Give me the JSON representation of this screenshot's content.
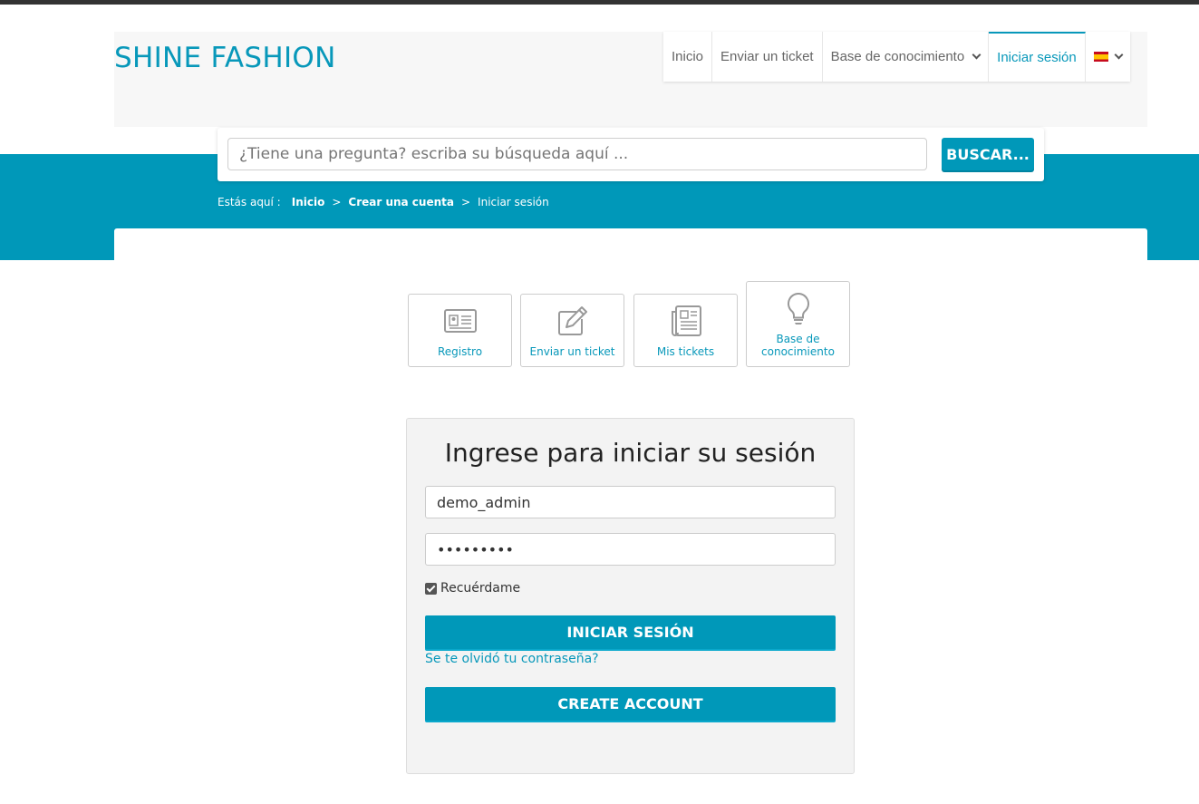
{
  "header": {
    "brand": "SHINE FASHION",
    "nav": [
      {
        "label": "Inicio"
      },
      {
        "label": "Enviar un ticket"
      },
      {
        "label": "Base de conocimiento"
      },
      {
        "label": "Iniciar sesión"
      }
    ],
    "language_icon": "spain-flag-icon"
  },
  "search": {
    "placeholder": "¿Tiene una pregunta? escriba su búsqueda aquí ...",
    "button_label": "BUSCAR..."
  },
  "breadcrumb": {
    "label": "Estás aquí :",
    "items": [
      "Inicio",
      "Crear una cuenta",
      "Iniciar sesión"
    ],
    "separator": ">"
  },
  "tiles": [
    {
      "label": "Registro",
      "icon": "id-card-icon"
    },
    {
      "label": "Enviar un ticket",
      "icon": "edit-icon"
    },
    {
      "label": "Mis tickets",
      "icon": "newspaper-icon"
    },
    {
      "label_line1": "Base de",
      "label_line2": "conocimiento",
      "icon": "lightbulb-icon"
    }
  ],
  "login": {
    "title": "Ingrese para iniciar su sesión",
    "username_value": "demo_admin",
    "password_value": "•••••••••",
    "remember_label": "Recuérdame",
    "remember_checked": true,
    "submit_label": "INICIAR SESIÓN",
    "forgot_label": "Se te olvidó tu contraseña?",
    "create_label": "CREATE ACCOUNT"
  },
  "colors": {
    "accent": "#0098b9",
    "brand": "#0898ba",
    "topbar": "#333333"
  }
}
